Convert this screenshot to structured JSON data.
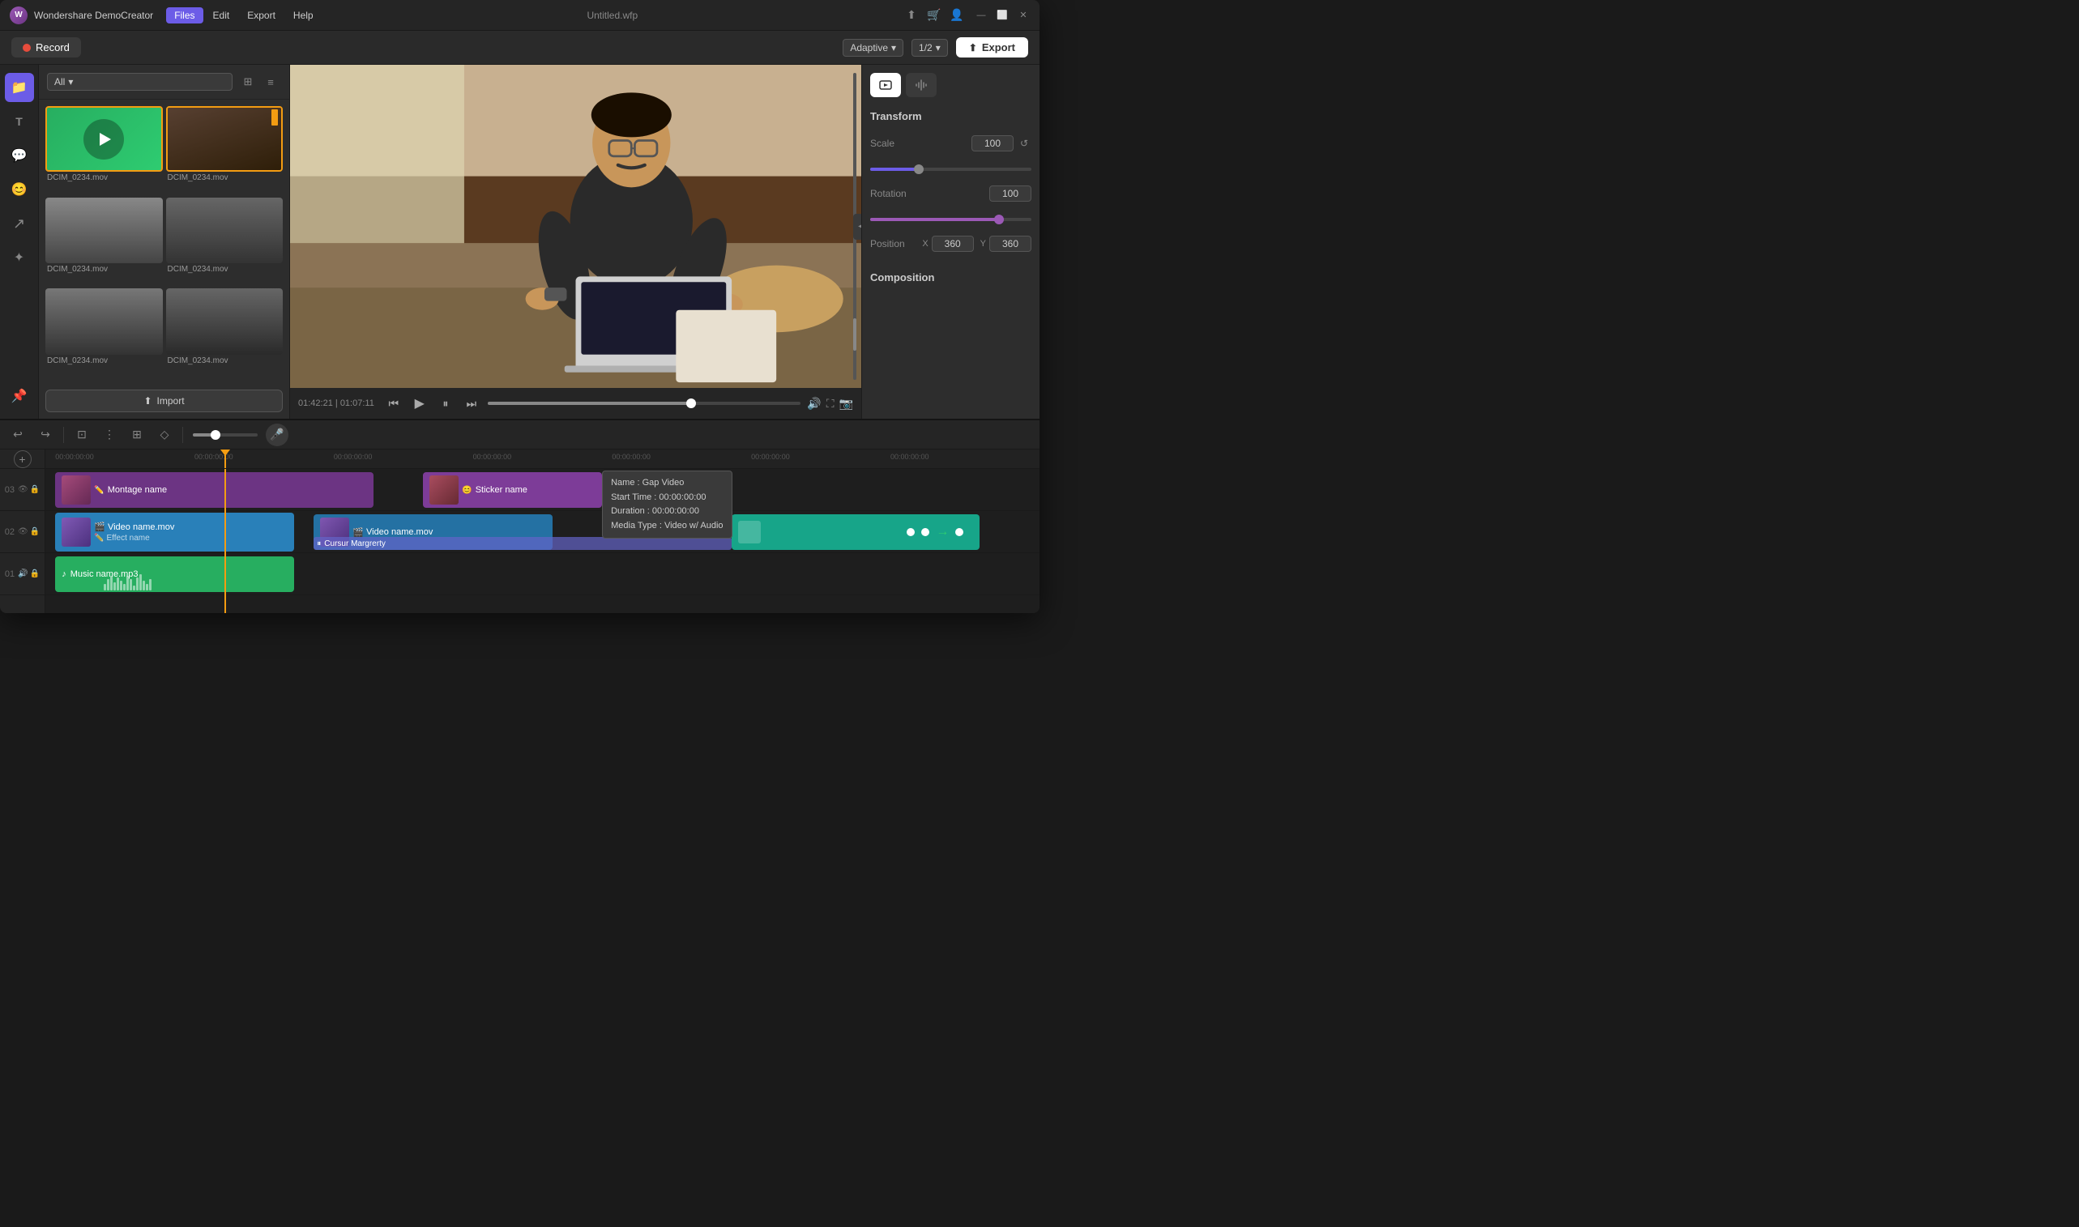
{
  "app": {
    "logo": "W",
    "name": "Wondershare DemoCreator",
    "title": "Untitled.wfp"
  },
  "titlebar": {
    "menu": [
      "Files",
      "Edit",
      "Export",
      "Help"
    ],
    "active_menu": "Files",
    "window_buttons": [
      "minimize",
      "maximize",
      "close"
    ]
  },
  "toolbar": {
    "record_label": "Record",
    "adaptive_label": "Adaptive",
    "ratio_label": "1/2",
    "export_label": "Export"
  },
  "sidebar": {
    "icons": [
      {
        "name": "folder-icon",
        "symbol": "📁",
        "active": true
      },
      {
        "name": "text-icon",
        "symbol": "T",
        "active": false
      },
      {
        "name": "speech-icon",
        "symbol": "💬",
        "active": false
      },
      {
        "name": "emoji-icon",
        "symbol": "😊",
        "active": false
      },
      {
        "name": "cursor-icon",
        "symbol": "↗",
        "active": false
      },
      {
        "name": "effects-icon",
        "symbol": "✦",
        "active": false
      },
      {
        "name": "pin-icon",
        "symbol": "📌",
        "active": false
      }
    ]
  },
  "media_panel": {
    "filter_label": "All",
    "files": [
      {
        "name": "DCIM_0234.mov",
        "thumb_class": "thumb-green",
        "selected": true
      },
      {
        "name": "DCIM_0234.mov",
        "thumb_class": "thumb-desk",
        "selected": true
      },
      {
        "name": "DCIM_0234.mov",
        "thumb_class": "thumb-room1",
        "selected": false
      },
      {
        "name": "DCIM_0234.mov",
        "thumb_class": "thumb-room2",
        "selected": false
      },
      {
        "name": "DCIM_0234.mov",
        "thumb_class": "thumb-room3",
        "selected": false
      },
      {
        "name": "DCIM_0234.mov",
        "thumb_class": "thumb-room4",
        "selected": false
      }
    ],
    "import_label": "Import"
  },
  "player": {
    "current_time": "01:42:21",
    "total_time": "01:07:11",
    "progress_pct": 65
  },
  "right_panel": {
    "tabs": [
      {
        "name": "video-tab",
        "symbol": "🎬",
        "active": true
      },
      {
        "name": "audio-tab",
        "symbol": "🔊",
        "active": false
      }
    ],
    "transform": {
      "title": "Transform",
      "scale_label": "Scale",
      "scale_value": "100",
      "scale_pct": 30,
      "rotation_label": "Rotation",
      "rotation_value": "100",
      "rotation_pct": 80,
      "position_label": "Position",
      "x_label": "X",
      "x_value": "360",
      "y_label": "Y",
      "y_value": "360"
    },
    "composition": {
      "title": "Composition"
    }
  },
  "timeline": {
    "tools": [
      "undo",
      "redo",
      "crop",
      "split",
      "wrap",
      "keyframe"
    ],
    "zoom_pct": 35,
    "tracks": [
      {
        "num": "03",
        "clips": [
          {
            "type": "montage",
            "label": "Montage name",
            "icon": "✏️"
          },
          {
            "type": "sticker",
            "label": "Sticker name",
            "icon": "😊"
          }
        ]
      },
      {
        "num": "02",
        "clips": [
          {
            "type": "video1",
            "label": "Video name.mov",
            "subicon": "🎬",
            "effect": "Effect name"
          },
          {
            "type": "video2",
            "label": "Video name.mov",
            "subicon": "🎬"
          },
          {
            "type": "video3",
            "label": "",
            "has_motion": true
          },
          {
            "type": "cursor",
            "label": "Cursur Margrerty"
          }
        ]
      },
      {
        "num": "01",
        "clips": [
          {
            "type": "music",
            "label": "Music name.mp3",
            "icon": "♪"
          }
        ]
      }
    ],
    "gap_tooltip": {
      "name": "Name : Gap Video",
      "start": "Start Time : 00:00:00:00",
      "duration": "Duration : 00:00:00:00",
      "media": "Media Type : Video w/ Audio"
    },
    "ruler_times": [
      "00:00:00:00",
      "00:00:00:00",
      "00:00:00:00",
      "00:00:00:00",
      "00:00:00:00",
      "00:00:00:00",
      "00:00:00:00"
    ]
  }
}
